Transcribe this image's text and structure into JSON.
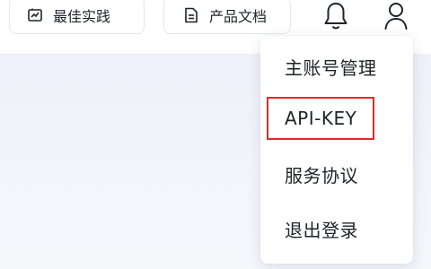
{
  "header": {
    "best_practice_label": "最佳实践",
    "docs_label": "产品文档",
    "icons": {
      "best_practice": "practice-icon",
      "docs": "document-icon",
      "notifications": "bell-icon",
      "account": "user-icon"
    }
  },
  "account_menu": {
    "items": [
      {
        "label": "主账号管理"
      },
      {
        "label": "API-KEY"
      },
      {
        "label": "服务协议"
      },
      {
        "label": "退出登录"
      }
    ]
  },
  "colors": {
    "highlight_border": "#e02a2a",
    "content_background": "#eef1fa",
    "text": "#1f2329"
  }
}
